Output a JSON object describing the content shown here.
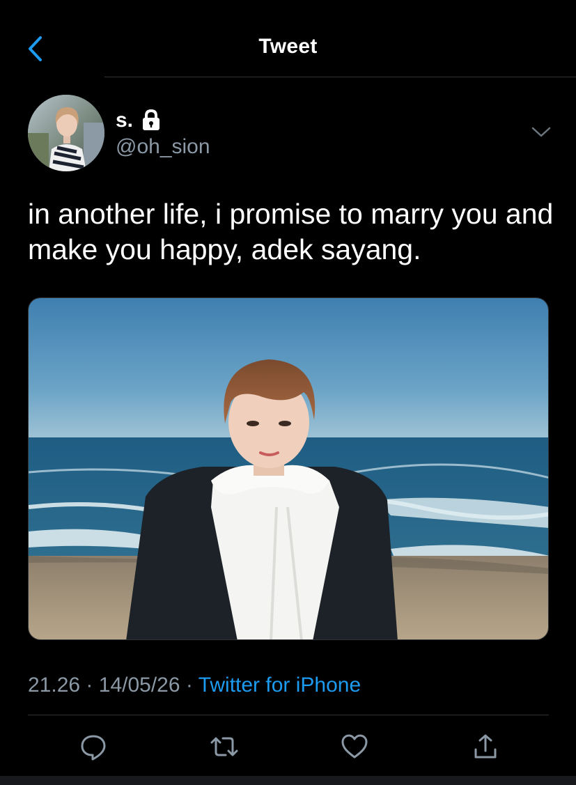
{
  "header": {
    "title": "Tweet",
    "back_icon": "chevron-left-icon"
  },
  "author": {
    "display_name": "s.",
    "handle": "@oh_sion",
    "protected_icon": "lock-icon"
  },
  "tweet": {
    "text": "in another life, i promise to marry you and make you happy, adek sayang."
  },
  "meta": {
    "time": "21.26",
    "separator": "·",
    "date": "14/05/26",
    "source": "Twitter for iPhone"
  },
  "actions": [
    "reply-icon",
    "retweet-icon",
    "like-icon",
    "share-icon"
  ],
  "colors": {
    "background": "#000000",
    "accent": "#1d9bf0",
    "muted_text": "#8b98a5",
    "divider": "#2f3336"
  }
}
